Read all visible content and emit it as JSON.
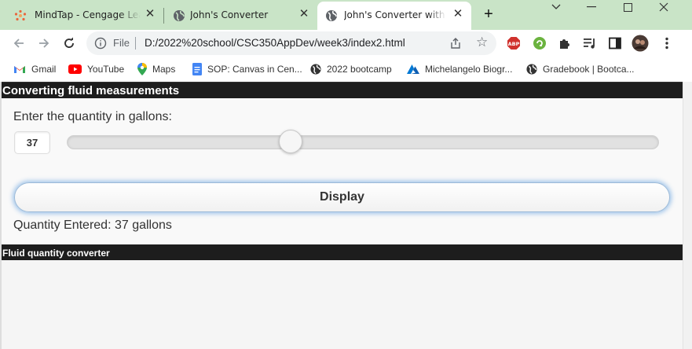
{
  "browser": {
    "tabs": [
      {
        "title": "MindTap - Cengage Learning",
        "active": false,
        "icon": "mindtap-icon"
      },
      {
        "title": "John's Converter",
        "active": false,
        "icon": "globe-icon"
      },
      {
        "title": "John's Converter with Slider",
        "active": true,
        "icon": "globe-icon"
      }
    ],
    "new_tab_symbol": "+",
    "address": {
      "scheme_label": "File",
      "url": "D:/2022%20school/CSC350AppDev/week3/index2.html"
    },
    "extensions": [
      "abp-icon",
      "grammarly-icon",
      "puzzle-icon",
      "media-control-icon",
      "sidepanel-icon",
      "profile-avatar"
    ],
    "bookmarks": [
      {
        "label": "Gmail",
        "icon": "gmail-icon"
      },
      {
        "label": "YouTube",
        "icon": "youtube-icon"
      },
      {
        "label": "Maps",
        "icon": "maps-icon"
      },
      {
        "label": "SOP: Canvas in Cen...",
        "icon": "docs-icon"
      },
      {
        "label": "2022 bootcamp",
        "icon": "globe-icon"
      },
      {
        "label": "Michelangelo Biogr...",
        "icon": "azure-icon"
      },
      {
        "label": "Gradebook | Bootca...",
        "icon": "globe-icon"
      }
    ],
    "colors": {
      "tabstrip": "#c9e4c7",
      "active_tab": "#ffffff"
    }
  },
  "page": {
    "header_title": "Converting fluid measurements",
    "prompt_label": "Enter the quantity in gallons:",
    "quantity_value": "37",
    "slider": {
      "value": 37,
      "min": 0,
      "max": 100
    },
    "display_button_label": "Display",
    "result_text": "Quantity Entered: 37 gallons",
    "footer_title": "Fluid quantity converter",
    "colors": {
      "bar": "#1d1d1d",
      "button_glow": "#3888d9"
    }
  }
}
